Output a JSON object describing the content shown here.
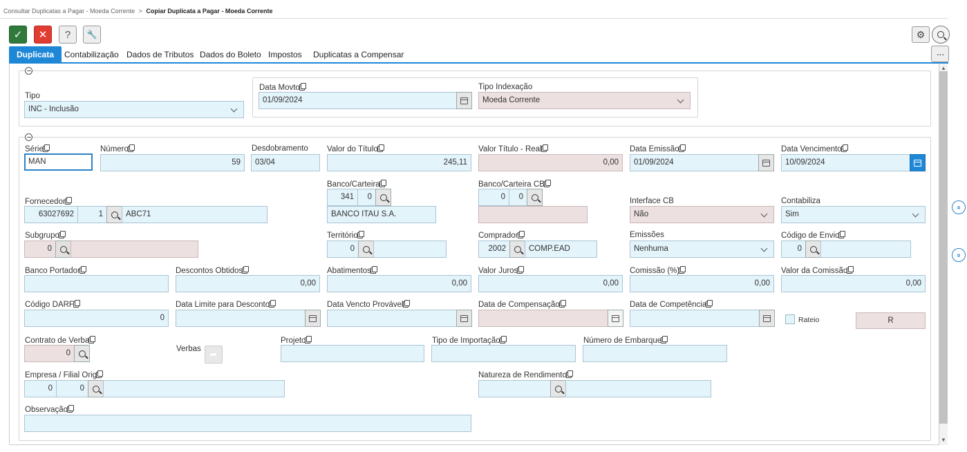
{
  "breadcrumb": {
    "parent": "Consultar Duplicatas a Pagar - Moeda Corrente",
    "separator": ">",
    "current": "Copiar Duplicata a Pagar - Moeda Corrente"
  },
  "toolbar": {
    "confirm": "✓",
    "cancel": "✕",
    "help": "?",
    "tools": "🔧",
    "settings": "⚙",
    "more": "···"
  },
  "tabs": [
    "Duplicata",
    "Contabilização",
    "Dados de Tributos",
    "Dados do Boleto",
    "Impostos",
    "Duplicatas a Compensar"
  ],
  "section1": {
    "tipo_label": "Tipo",
    "tipo_value": "INC - Inclusão",
    "data_movto_label": "Data Movto",
    "data_movto_value": "01/09/2024",
    "tipo_indexacao_label": "Tipo Indexação",
    "tipo_indexacao_value": "Moeda Corrente"
  },
  "section2": {
    "serie_label": "Série",
    "serie_value": "MAN",
    "numero_label": "Número",
    "numero_value": "59",
    "desdobramento_label": "Desdobramento",
    "desdobramento_value": "03/04",
    "valor_titulo_label": "Valor do Título",
    "valor_titulo_value": "245,11",
    "valor_titulo_real_label": "Valor Título - Real",
    "valor_titulo_real_value": "0,00",
    "data_emissao_label": "Data Emissão",
    "data_emissao_value": "01/09/2024",
    "data_vencimento_label": "Data Vencimento",
    "data_vencimento_value": "10/09/2024",
    "banco_carteira_label": "Banco/Carteira",
    "banco_value": "341",
    "carteira_value": "0",
    "banco_nome": "BANCO ITAU S.A.",
    "banco_carteira_cb_label": "Banco/Carteira CB",
    "banco_cb_value": "0",
    "carteira_cb_value": "0",
    "fornecedor_label": "Fornecedor",
    "fornecedor_code": "63027692",
    "fornecedor_filial": "1",
    "fornecedor_nome": "ABC71",
    "interface_cb_label": "Interface CB",
    "interface_cb_value": "Não",
    "contabiliza_label": "Contabiliza",
    "contabiliza_value": "Sim",
    "subgrupo_label": "Subgrupo",
    "subgrupo_value": "0",
    "territorio_label": "Território",
    "territorio_value": "0",
    "comprador_label": "Comprador",
    "comprador_code": "2002",
    "comprador_nome": "COMP.EAD",
    "emissoes_label": "Emissões",
    "emissoes_value": "Nenhuma",
    "codigo_envio_label": "Código de Envio",
    "codigo_envio_value": "0",
    "banco_portador_label": "Banco Portador",
    "descontos_label": "Descontos Obtidos",
    "descontos_value": "0,00",
    "abatimentos_label": "Abatimentos",
    "abatimentos_value": "0,00",
    "valor_juros_label": "Valor Juros",
    "valor_juros_value": "0,00",
    "comissao_label": "Comissão (%)",
    "comissao_value": "0,00",
    "valor_comissao_label": "Valor da Comissão",
    "valor_comissao_value": "0,00",
    "codigo_darf_label": "Código DARF",
    "codigo_darf_value": "0",
    "data_limite_label": "Data Limite para Desconto",
    "data_vencto_provavel_label": "Data Vencto Provável",
    "data_compensacao_label": "Data de Compensação",
    "data_competencia_label": "Data de Competência",
    "rateio_label": "Rateio",
    "r_button": "R",
    "contrato_verba_label": "Contrato de Verba",
    "contrato_verba_value": "0",
    "verbas_label": "Verbas",
    "projeto_label": "Projeto",
    "tipo_importacao_label": "Tipo de Importação",
    "numero_embarque_label": "Número de Embarque",
    "empresa_filial_label": "Empresa / Filial Orig",
    "empresa_value": "0",
    "filial_value": "0",
    "natureza_rendimento_label": "Natureza de Rendimento",
    "observacao_label": "Observação"
  },
  "side": {
    "up": "»",
    "down": "»"
  },
  "colors": {
    "accent": "#1e88d6",
    "input_bg": "#e4f4fb",
    "disabled_bg": "#ece0e0",
    "ok": "#2f7a3a",
    "cancel": "#e03c32"
  }
}
